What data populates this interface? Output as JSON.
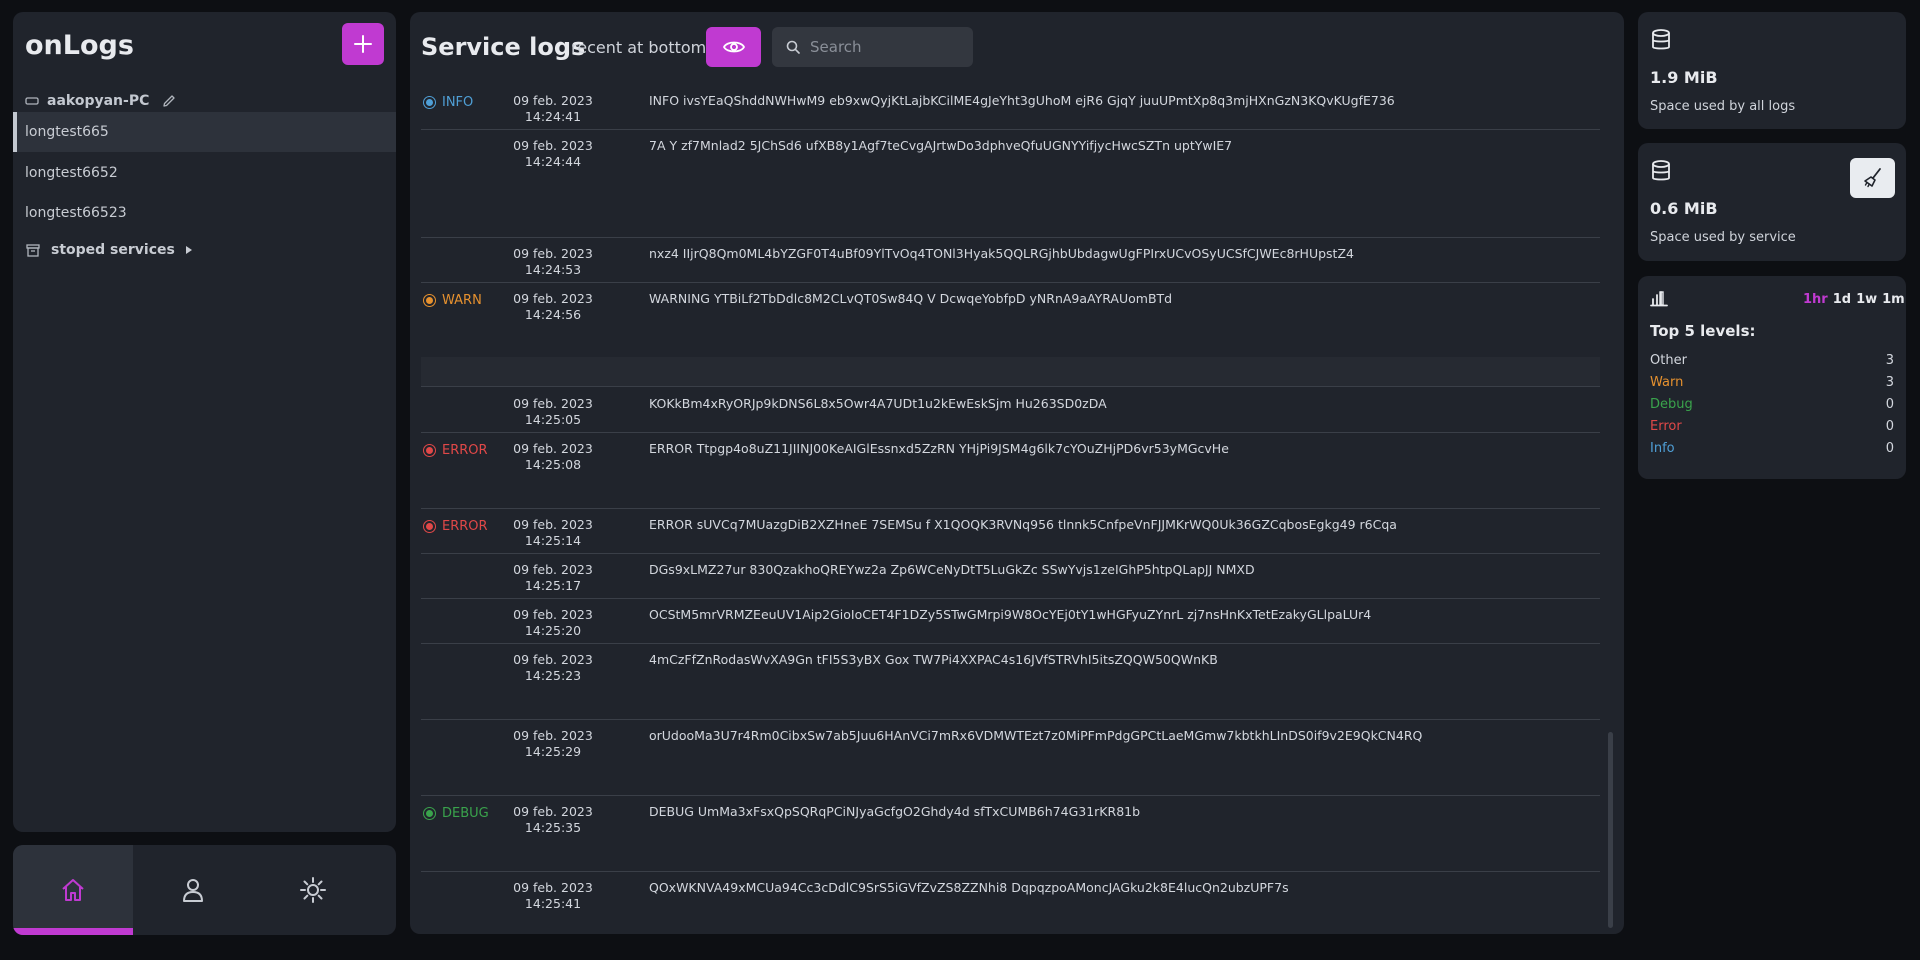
{
  "sidebar": {
    "app_title": "onLogs",
    "host_name": "aakopyan-PC",
    "services": [
      {
        "label": "longtest665"
      },
      {
        "label": "longtest6652"
      },
      {
        "label": "longtest66523"
      }
    ],
    "stopped_label": "stoped services"
  },
  "main": {
    "title": "Service logs",
    "order_label": "recent at bottom",
    "search_placeholder": "Search",
    "logs": [
      {
        "level": "INFO",
        "date": "09 feb. 2023",
        "time": "14:24:41",
        "message": "INFO ivsYEaQShddNWHwM9 eb9xwQyjKtLajbKCilME4gJeYht3gUhoM ejR6 GjqY juuUPmtXp8q3mjHXnGzN3KQvKUgfE736"
      },
      {
        "level": "",
        "date": "09 feb. 2023",
        "time": "14:24:44",
        "message": "7A Y zf7Mnlad2 5JChSd6 ufXB8y1Agf7teCvgAJrtwDo3dphveQfuUGNYYifjycHwcSZTn uptYwIE7"
      },
      {
        "level": "",
        "date": "09 feb. 2023",
        "time": "14:24:53",
        "message": "nxz4 IIjrQ8Qm0ML4bYZGF0T4uBf09YlTvOq4TONl3Hyak5QQLRGjhbUbdagwUgFPIrxUCvOSyUCSfCJWEc8rHUpstZ4"
      },
      {
        "level": "WARN",
        "date": "09 feb. 2023",
        "time": "14:24:56",
        "message": "WARNING YTBiLf2TbDdlc8M2CLvQT0Sw84Q V DcwqeYobfpD yNRnA9aAYRAUomBTd"
      },
      {
        "level": "",
        "date": "09 feb. 2023",
        "time": "14:25:05",
        "message": "KOKkBm4xRyORJp9kDNS6L8x5Owr4A7UDt1u2kEwEskSjm Hu263SD0zDA"
      },
      {
        "level": "ERROR",
        "date": "09 feb. 2023",
        "time": "14:25:08",
        "message": "ERROR Ttpgp4o8uZ11JIINJ00KeAIGlEssnxd5ZzRN YHjPi9JSM4g6lk7cYOuZHjPD6vr53yMGcvHe"
      },
      {
        "level": "ERROR",
        "date": "09 feb. 2023",
        "time": "14:25:14",
        "message": "ERROR sUVCq7MUazgDiB2XZHneE 7SEMSu f X1QOQK3RVNq956 tlnnk5CnfpeVnFJJMKrWQ0Uk36GZCqbosEgkg49 r6Cqa"
      },
      {
        "level": "",
        "date": "09 feb. 2023",
        "time": "14:25:17",
        "message": "DGs9xLMZ27ur 830QzakhoQREYwz2a Zp6WCeNyDtT5LuGkZc SSwYvjs1zeIGhP5htpQLapJJ NMXD"
      },
      {
        "level": "",
        "date": "09 feb. 2023",
        "time": "14:25:20",
        "message": "OCStM5mrVRMZEeuUV1Aip2GioIoCET4F1DZy5STwGMrpi9W8OcYEj0tY1wHGFyuZYnrL zj7nsHnKxTetEzakyGLlpaLUr4"
      },
      {
        "level": "",
        "date": "09 feb. 2023",
        "time": "14:25:23",
        "message": "4mCzFfZnRodasWvXA9Gn tFI5S3yBX Gox TW7Pi4XXPAC4s16JVfSTRVhI5itsZQQW50QWnKB"
      },
      {
        "level": "",
        "date": "09 feb. 2023",
        "time": "14:25:29",
        "message": "orUdooMa3U7r4Rm0CibxSw7ab5Juu6HAnVCi7mRx6VDMWTEzt7z0MiPFmPdgGPCtLaeMGmw7kbtkhLInDS0if9v2E9QkCN4RQ"
      },
      {
        "level": "DEBUG",
        "date": "09 feb. 2023",
        "time": "14:25:35",
        "message": "DEBUG UmMa3xFsxQpSQRqPCiNJyaGcfgO2Ghdy4d sfTxCUMB6h74G31rKR81b"
      },
      {
        "level": "",
        "date": "09 feb. 2023",
        "time": "14:25:41",
        "message": "QOxWKNVA49xMCUa94Cc3cDdlC9SrS5iGVfZvZS8ZZNhi8 DqpqzpoAMoncJAGku2k8E4lucQn2ubzUPF7s"
      }
    ]
  },
  "stats": {
    "all_logs_value": "1.9 MiB",
    "all_logs_caption": "Space used by all logs",
    "service_value": "0.6 MiB",
    "service_caption": "Space used by service",
    "ranges": [
      "1hr",
      "1d",
      "1w",
      "1m"
    ],
    "selected_range": "1hr",
    "top_title": "Top 5 levels:",
    "levels": [
      {
        "name": "Other",
        "count": "3",
        "color": "#d3d7de"
      },
      {
        "name": "Warn",
        "count": "3",
        "color": "#e6912f"
      },
      {
        "name": "Debug",
        "count": "0",
        "color": "#3aa34c"
      },
      {
        "name": "Error",
        "count": "0",
        "color": "#e04848"
      },
      {
        "name": "Info",
        "count": "0",
        "color": "#4f9fd6"
      }
    ]
  },
  "colors": {
    "accent": "#c03ad1",
    "info": "#4f9fd6",
    "warn": "#e6912f",
    "error": "#e04848",
    "debug": "#3aa34c"
  }
}
